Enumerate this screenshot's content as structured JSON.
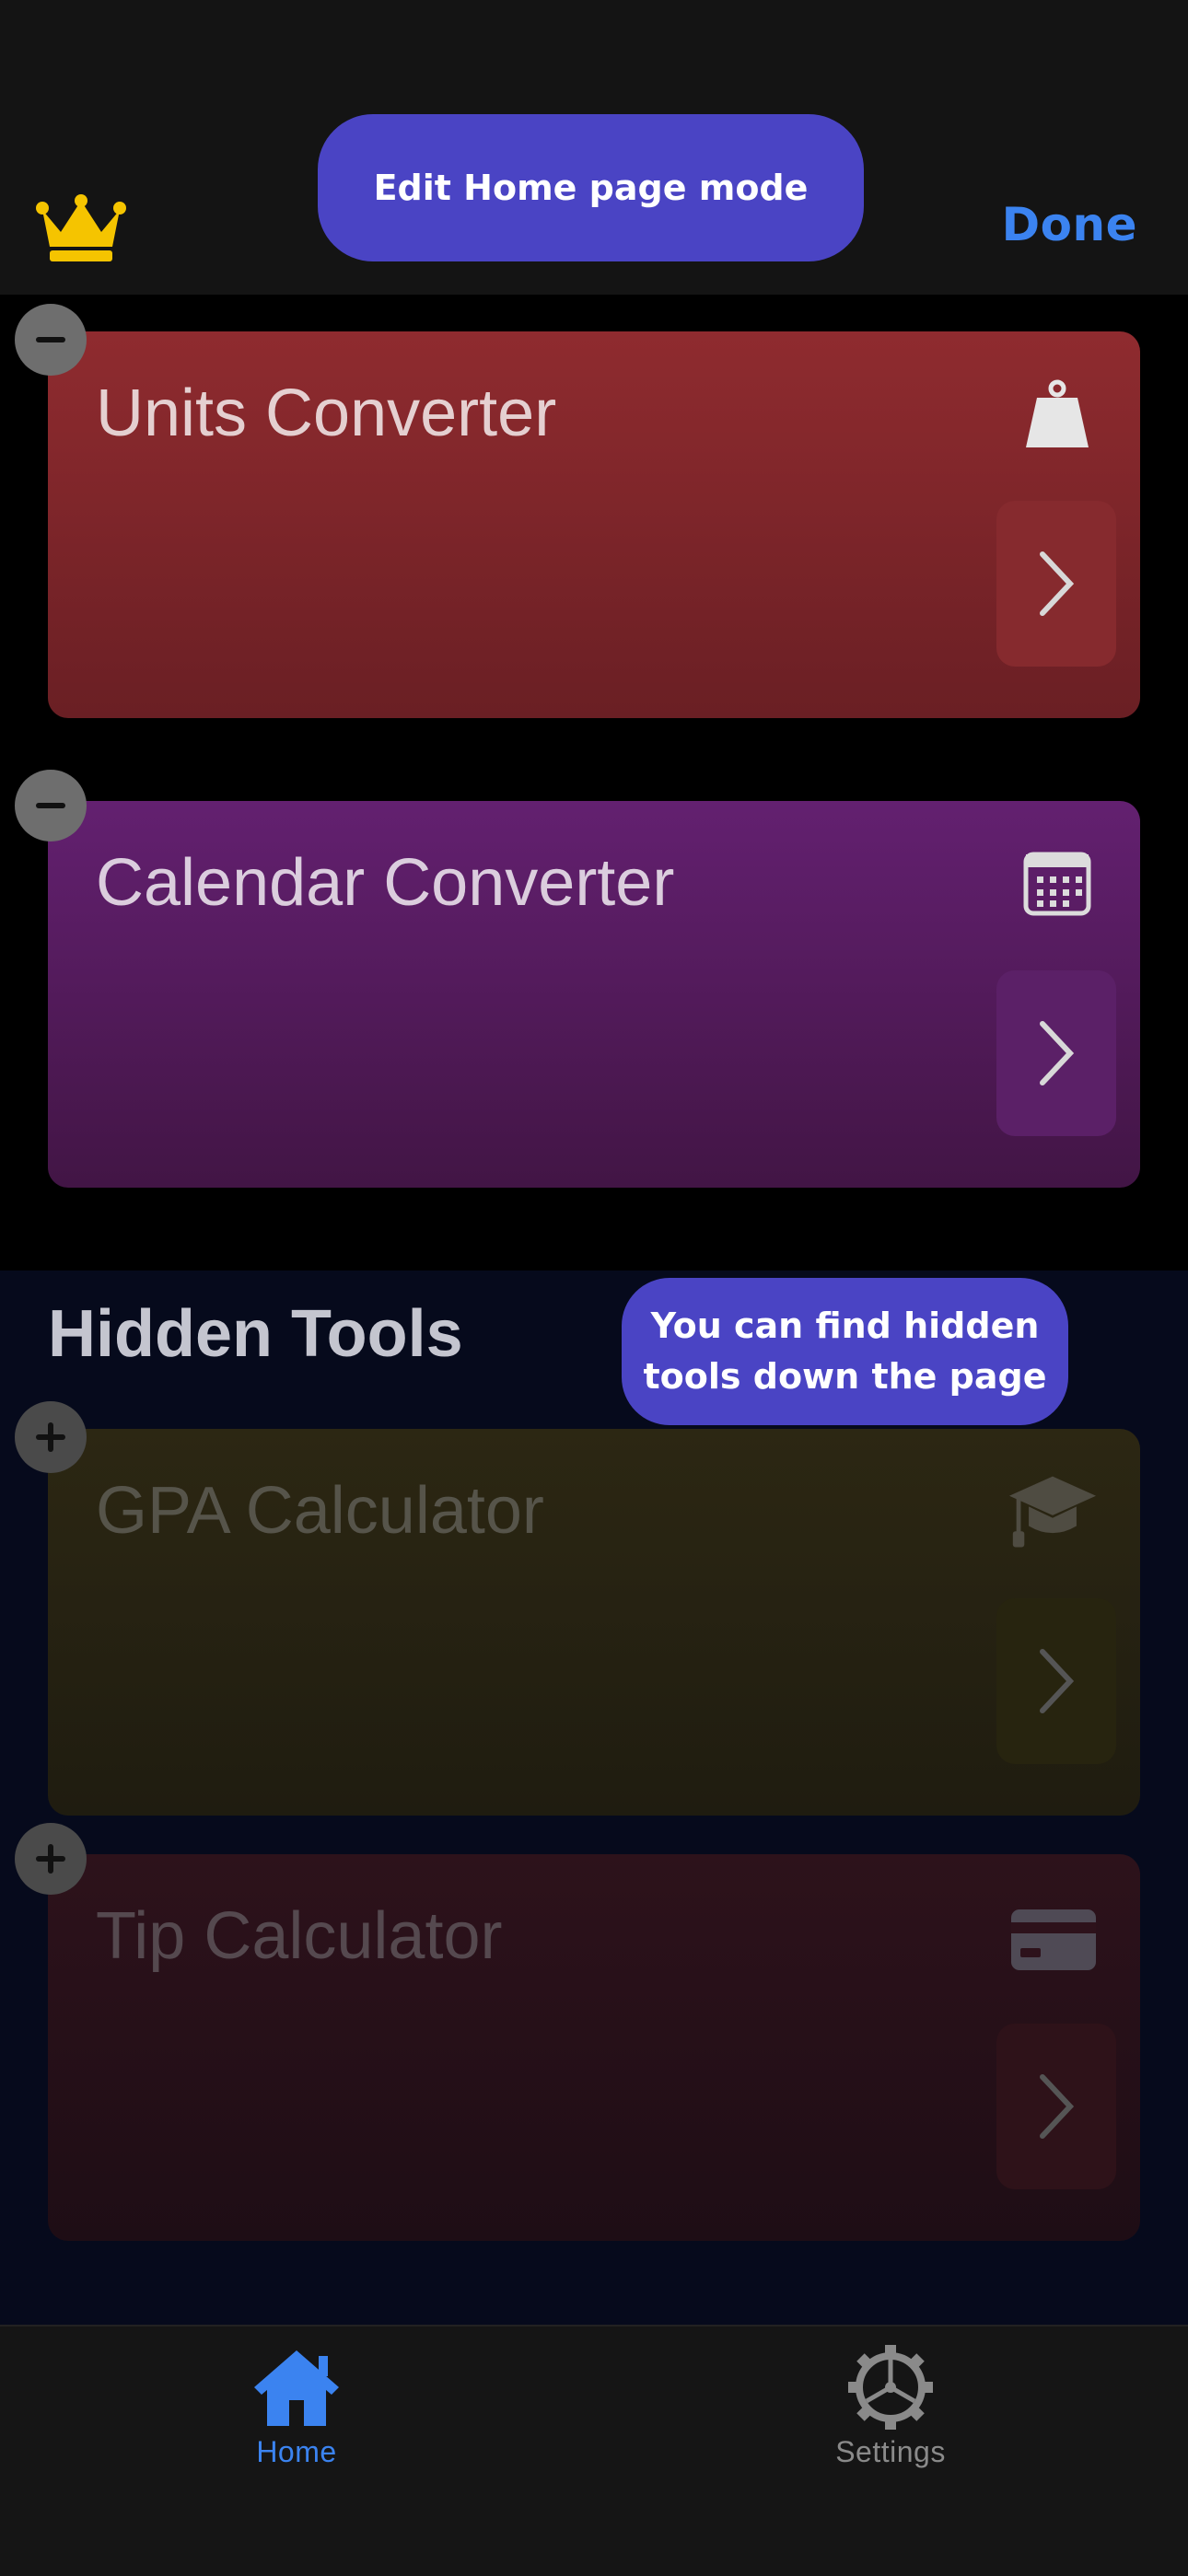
{
  "header": {
    "edit_mode_label": "Edit Home page mode",
    "done_label": "Done"
  },
  "active_tools": [
    {
      "name": "Units Converter",
      "icon": "weight-icon",
      "color": "#8a2a2e"
    },
    {
      "name": "Calendar Converter",
      "icon": "calendar-icon",
      "color": "#5e1f6b"
    }
  ],
  "hidden_section": {
    "title": "Hidden Tools",
    "tip": "You can find hidden tools down the page",
    "tools": [
      {
        "name": "GPA Calculator",
        "icon": "graduation-cap-icon",
        "color": "#2a2612"
      },
      {
        "name": "Tip Calculator",
        "icon": "credit-card-icon",
        "color": "#2b121a"
      }
    ]
  },
  "tabbar": {
    "home_label": "Home",
    "settings_label": "Settings",
    "active": "Home",
    "accent": "#3b83f0"
  }
}
